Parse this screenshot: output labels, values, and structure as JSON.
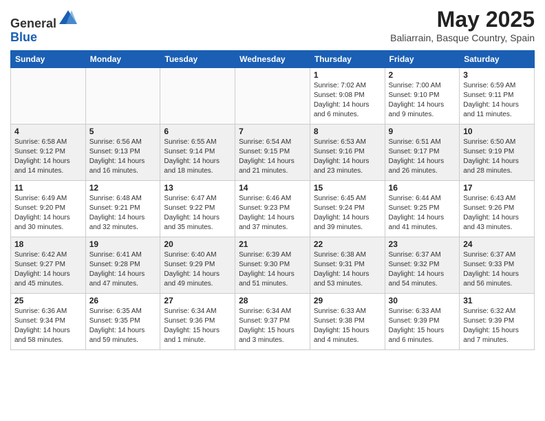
{
  "header": {
    "logo_line1": "General",
    "logo_line2": "Blue",
    "month": "May 2025",
    "location": "Baliarrain, Basque Country, Spain"
  },
  "days_of_week": [
    "Sunday",
    "Monday",
    "Tuesday",
    "Wednesday",
    "Thursday",
    "Friday",
    "Saturday"
  ],
  "weeks": [
    [
      {
        "day": "",
        "info": ""
      },
      {
        "day": "",
        "info": ""
      },
      {
        "day": "",
        "info": ""
      },
      {
        "day": "",
        "info": ""
      },
      {
        "day": "1",
        "info": "Sunrise: 7:02 AM\nSunset: 9:08 PM\nDaylight: 14 hours\nand 6 minutes."
      },
      {
        "day": "2",
        "info": "Sunrise: 7:00 AM\nSunset: 9:10 PM\nDaylight: 14 hours\nand 9 minutes."
      },
      {
        "day": "3",
        "info": "Sunrise: 6:59 AM\nSunset: 9:11 PM\nDaylight: 14 hours\nand 11 minutes."
      }
    ],
    [
      {
        "day": "4",
        "info": "Sunrise: 6:58 AM\nSunset: 9:12 PM\nDaylight: 14 hours\nand 14 minutes."
      },
      {
        "day": "5",
        "info": "Sunrise: 6:56 AM\nSunset: 9:13 PM\nDaylight: 14 hours\nand 16 minutes."
      },
      {
        "day": "6",
        "info": "Sunrise: 6:55 AM\nSunset: 9:14 PM\nDaylight: 14 hours\nand 18 minutes."
      },
      {
        "day": "7",
        "info": "Sunrise: 6:54 AM\nSunset: 9:15 PM\nDaylight: 14 hours\nand 21 minutes."
      },
      {
        "day": "8",
        "info": "Sunrise: 6:53 AM\nSunset: 9:16 PM\nDaylight: 14 hours\nand 23 minutes."
      },
      {
        "day": "9",
        "info": "Sunrise: 6:51 AM\nSunset: 9:17 PM\nDaylight: 14 hours\nand 26 minutes."
      },
      {
        "day": "10",
        "info": "Sunrise: 6:50 AM\nSunset: 9:19 PM\nDaylight: 14 hours\nand 28 minutes."
      }
    ],
    [
      {
        "day": "11",
        "info": "Sunrise: 6:49 AM\nSunset: 9:20 PM\nDaylight: 14 hours\nand 30 minutes."
      },
      {
        "day": "12",
        "info": "Sunrise: 6:48 AM\nSunset: 9:21 PM\nDaylight: 14 hours\nand 32 minutes."
      },
      {
        "day": "13",
        "info": "Sunrise: 6:47 AM\nSunset: 9:22 PM\nDaylight: 14 hours\nand 35 minutes."
      },
      {
        "day": "14",
        "info": "Sunrise: 6:46 AM\nSunset: 9:23 PM\nDaylight: 14 hours\nand 37 minutes."
      },
      {
        "day": "15",
        "info": "Sunrise: 6:45 AM\nSunset: 9:24 PM\nDaylight: 14 hours\nand 39 minutes."
      },
      {
        "day": "16",
        "info": "Sunrise: 6:44 AM\nSunset: 9:25 PM\nDaylight: 14 hours\nand 41 minutes."
      },
      {
        "day": "17",
        "info": "Sunrise: 6:43 AM\nSunset: 9:26 PM\nDaylight: 14 hours\nand 43 minutes."
      }
    ],
    [
      {
        "day": "18",
        "info": "Sunrise: 6:42 AM\nSunset: 9:27 PM\nDaylight: 14 hours\nand 45 minutes."
      },
      {
        "day": "19",
        "info": "Sunrise: 6:41 AM\nSunset: 9:28 PM\nDaylight: 14 hours\nand 47 minutes."
      },
      {
        "day": "20",
        "info": "Sunrise: 6:40 AM\nSunset: 9:29 PM\nDaylight: 14 hours\nand 49 minutes."
      },
      {
        "day": "21",
        "info": "Sunrise: 6:39 AM\nSunset: 9:30 PM\nDaylight: 14 hours\nand 51 minutes."
      },
      {
        "day": "22",
        "info": "Sunrise: 6:38 AM\nSunset: 9:31 PM\nDaylight: 14 hours\nand 53 minutes."
      },
      {
        "day": "23",
        "info": "Sunrise: 6:37 AM\nSunset: 9:32 PM\nDaylight: 14 hours\nand 54 minutes."
      },
      {
        "day": "24",
        "info": "Sunrise: 6:37 AM\nSunset: 9:33 PM\nDaylight: 14 hours\nand 56 minutes."
      }
    ],
    [
      {
        "day": "25",
        "info": "Sunrise: 6:36 AM\nSunset: 9:34 PM\nDaylight: 14 hours\nand 58 minutes."
      },
      {
        "day": "26",
        "info": "Sunrise: 6:35 AM\nSunset: 9:35 PM\nDaylight: 14 hours\nand 59 minutes."
      },
      {
        "day": "27",
        "info": "Sunrise: 6:34 AM\nSunset: 9:36 PM\nDaylight: 15 hours\nand 1 minute."
      },
      {
        "day": "28",
        "info": "Sunrise: 6:34 AM\nSunset: 9:37 PM\nDaylight: 15 hours\nand 3 minutes."
      },
      {
        "day": "29",
        "info": "Sunrise: 6:33 AM\nSunset: 9:38 PM\nDaylight: 15 hours\nand 4 minutes."
      },
      {
        "day": "30",
        "info": "Sunrise: 6:33 AM\nSunset: 9:39 PM\nDaylight: 15 hours\nand 6 minutes."
      },
      {
        "day": "31",
        "info": "Sunrise: 6:32 AM\nSunset: 9:39 PM\nDaylight: 15 hours\nand 7 minutes."
      }
    ]
  ]
}
